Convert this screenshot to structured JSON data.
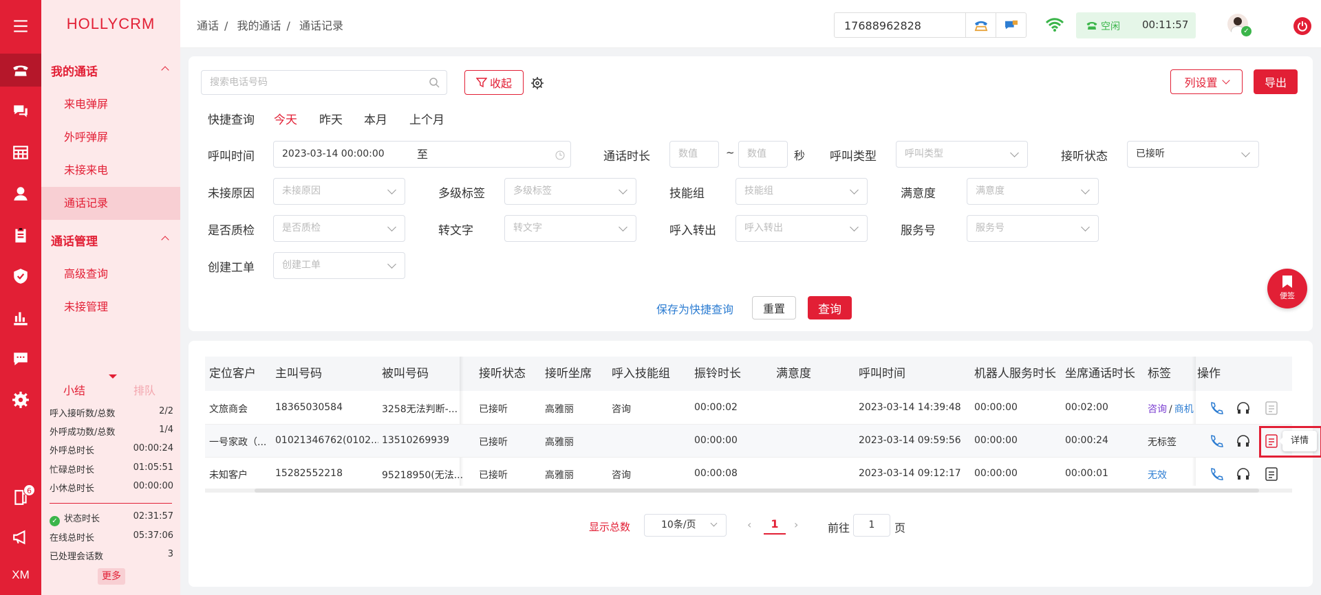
{
  "app": {
    "logo": "HOLLYCRM"
  },
  "rail": {
    "icons": [
      "menu-icon",
      "phone-icon",
      "chat-icon",
      "grid-icon",
      "user-icon",
      "clipboard-icon",
      "shield-icon",
      "bar-chart-icon",
      "message-icon",
      "gear-icon",
      "book-icon",
      "megaphone-icon"
    ],
    "book_badge": "6",
    "bottom_text": "XM"
  },
  "sidebar": {
    "group1": "我的通话",
    "group1_items": [
      "来电弹屏",
      "外呼弹屏",
      "未接来电",
      "通话记录"
    ],
    "group2": "通话管理",
    "group2_items": [
      "高级查询",
      "未接管理"
    ]
  },
  "summary": {
    "tab_active": "小结",
    "tab_inactive": "排队",
    "rows": [
      {
        "label": "呼入接听数/总数",
        "value": "2/2"
      },
      {
        "label": "外呼成功数/总数",
        "value": "1/4"
      },
      {
        "label": "外呼总时长",
        "value": "00:00:24"
      },
      {
        "label": "忙碌总时长",
        "value": "01:05:51"
      },
      {
        "label": "小休总时长",
        "value": "00:00:00"
      },
      {
        "label": "状态时长",
        "value": "02:31:57"
      },
      {
        "label": "在线总时长",
        "value": "05:37:06"
      },
      {
        "label": "已处理会话数",
        "value": "3"
      }
    ],
    "more": "更多"
  },
  "header": {
    "breadcrumb": [
      "通话",
      "我的通话",
      "通话记录"
    ],
    "phone": "17688962828",
    "status": "空闲",
    "timer": "00:11:57"
  },
  "filters": {
    "search_placeholder": "搜索电话号码",
    "collapse_label": "收起",
    "col_settings": "列设置",
    "export": "导出",
    "quick_label": "快捷查询",
    "quick_tabs": [
      "今天",
      "昨天",
      "本月",
      "上个月"
    ],
    "call_time_label": "呼叫时间",
    "call_time_start": "2023-03-14 00:00:00",
    "call_time_sep": "至",
    "duration_label": "通话时长",
    "num_placeholder": "数值",
    "tilde": "~",
    "sec": "秒",
    "call_type_label": "呼叫类型",
    "call_type_ph": "呼叫类型",
    "answer_label": "接听状态",
    "answer_val": "已接听",
    "miss_label": "未接原因",
    "miss_ph": "未接原因",
    "tag_label": "多级标签",
    "tag_ph": "多级标签",
    "skill_label": "技能组",
    "skill_ph": "技能组",
    "sat_label": "满意度",
    "sat_ph": "满意度",
    "qc_label": "是否质检",
    "qc_ph": "是否质检",
    "txt_label": "转文字",
    "txt_ph": "转文字",
    "inout_label": "呼入转出",
    "inout_ph": "呼入转出",
    "svc_label": "服务号",
    "svc_ph": "服务号",
    "wo_label": "创建工单",
    "wo_ph": "创建工单",
    "save_quick": "保存为快捷查询",
    "reset": "重置",
    "query": "查询"
  },
  "sticky_note": "便签",
  "table": {
    "headers": [
      "定位客户",
      "主叫号码",
      "被叫号码",
      "接听状态",
      "接听坐席",
      "呼入技能组",
      "振铃时长",
      "满意度",
      "呼叫时间",
      "机器人服务时长",
      "坐席通话时长",
      "标签",
      "操作"
    ],
    "rows": [
      {
        "cust": "文旅商会",
        "caller": "18365030584",
        "callee": "3258无法判断-...",
        "status": "已接听",
        "agent": "高雅丽",
        "skill": "咨询",
        "ring": "00:00:02",
        "sat": "",
        "time": "2023-03-14 14:39:48",
        "robot": "00:00:00",
        "talk": "00:02:00",
        "tag1": "咨询",
        "tag_sep": "/",
        "tag2": "商机"
      },
      {
        "cust": "一号家政（...",
        "caller": "01021346762(0102...",
        "callee": "13510269939",
        "status": "已接听",
        "agent": "高雅丽",
        "skill": "",
        "ring": "00:00:00",
        "sat": "",
        "time": "2023-03-14 09:59:56",
        "robot": "00:00:00",
        "talk": "00:00:24",
        "tag1": "无标签",
        "tag_sep": "",
        "tag2": ""
      },
      {
        "cust": "未知客户",
        "caller": "15282552218",
        "callee": "95218950(无法...",
        "status": "已接听",
        "agent": "高雅丽",
        "skill": "咨询",
        "ring": "00:00:08",
        "sat": "",
        "time": "2023-03-14 09:12:17",
        "robot": "00:00:00",
        "talk": "00:00:01",
        "tag1": "无效",
        "tag_sep": "",
        "tag2": ""
      }
    ],
    "tooltip": "详情"
  },
  "pager": {
    "total_label": "显示总数",
    "page_size": "10条/页",
    "current": "1",
    "goto_label": "前往",
    "goto_val": "1",
    "page_suffix": "页"
  },
  "colors": {
    "brand": "#e21f35",
    "link": "#2d7dd2",
    "green": "#3bb54a"
  }
}
